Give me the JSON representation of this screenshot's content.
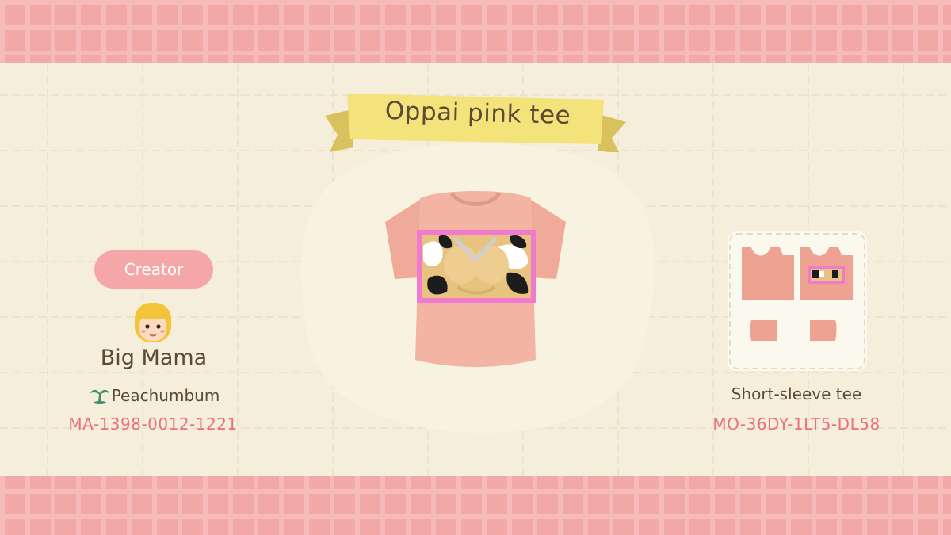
{
  "design": {
    "title": "Oppai pink tee",
    "item_type": "Short-sleeve tee",
    "design_id": "MO-36DY-1LT5-DL58"
  },
  "creator": {
    "label": "Creator",
    "name": "Big Mama",
    "island": "Peachumbum",
    "creator_id": "MA-1398-0012-1221"
  },
  "icons": {
    "avatar": "villager-avatar-icon",
    "island": "palm-tree-icon",
    "preview": "shirt-preview",
    "pattern": "pattern-layout"
  },
  "colors": {
    "background_pink": "#f2a3a3",
    "panel": "#f4eedb",
    "banner_yellow": "#f4e27a",
    "shirt": "#f3b4a4",
    "accent_pink": "#ec6f80",
    "text_brown": "#5b4a36"
  }
}
